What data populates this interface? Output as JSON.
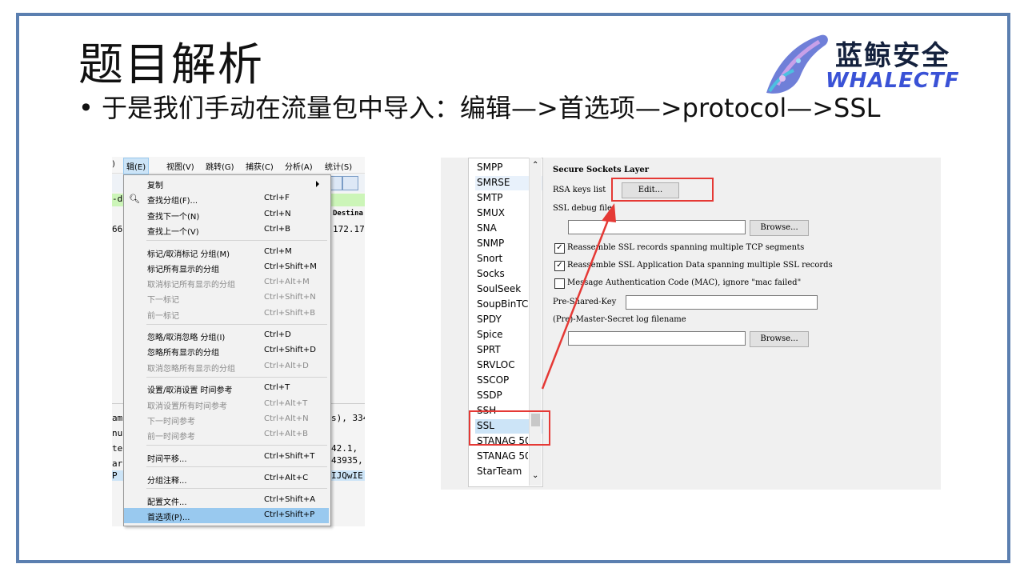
{
  "slide": {
    "title": "题目解析",
    "bullet": "• 于是我们手动在流量包中导入：编辑—>首选项—>protocol—>SSL"
  },
  "logo": {
    "cn": "蓝鲸安全",
    "en": "WHALECTF"
  },
  "left_screenshot": {
    "menubar": [
      "辑(E)",
      "视图(V)",
      "跳转(G)",
      "捕获(C)",
      "分析(A)",
      "统计(S)"
    ],
    "menubar_first": ")",
    "column_header": "Destina",
    "list_left": [
      "-d",
      "66"
    ],
    "list_right": [
      "172.17"
    ],
    "detail_left": [
      "am",
      "nu",
      "te",
      "ar",
      "P"
    ],
    "detail_right": [
      "s), 334",
      "42.1,",
      "43935,",
      "IJQwIE"
    ],
    "menu": {
      "items": [
        {
          "label": "复制",
          "shortcut": "",
          "disabled": false
        },
        {
          "label": "查找分组(F)...",
          "shortcut": "Ctrl+F",
          "disabled": false
        },
        {
          "label": "查找下一个(N)",
          "shortcut": "Ctrl+N",
          "disabled": false
        },
        {
          "label": "查找上一个(V)",
          "shortcut": "Ctrl+B",
          "disabled": false
        },
        {
          "label": "标记/取消标记 分组(M)",
          "shortcut": "Ctrl+M",
          "disabled": false
        },
        {
          "label": "标记所有显示的分组",
          "shortcut": "Ctrl+Shift+M",
          "disabled": false
        },
        {
          "label": "取消标记所有显示的分组",
          "shortcut": "Ctrl+Alt+M",
          "disabled": true
        },
        {
          "label": "下一标记",
          "shortcut": "Ctrl+Shift+N",
          "disabled": true
        },
        {
          "label": "前一标记",
          "shortcut": "Ctrl+Shift+B",
          "disabled": true
        },
        {
          "label": "忽略/取消忽略 分组(I)",
          "shortcut": "Ctrl+D",
          "disabled": false
        },
        {
          "label": "忽略所有显示的分组",
          "shortcut": "Ctrl+Shift+D",
          "disabled": false
        },
        {
          "label": "取消忽略所有显示的分组",
          "shortcut": "Ctrl+Alt+D",
          "disabled": true
        },
        {
          "label": "设置/取消设置 时间参考",
          "shortcut": "Ctrl+T",
          "disabled": false
        },
        {
          "label": "取消设置所有时间参考",
          "shortcut": "Ctrl+Alt+T",
          "disabled": true
        },
        {
          "label": "下一时间参考",
          "shortcut": "Ctrl+Alt+N",
          "disabled": true
        },
        {
          "label": "前一时间参考",
          "shortcut": "Ctrl+Alt+B",
          "disabled": true
        },
        {
          "label": "时间平移...",
          "shortcut": "Ctrl+Shift+T",
          "disabled": false
        },
        {
          "label": "分组注释...",
          "shortcut": "Ctrl+Alt+C",
          "disabled": false
        },
        {
          "label": "配置文件...",
          "shortcut": "Ctrl+Shift+A",
          "disabled": false
        },
        {
          "label": "首选项(P)...",
          "shortcut": "Ctrl+Shift+P",
          "disabled": false,
          "highlighted": true
        }
      ]
    }
  },
  "right_screenshot": {
    "protocols": [
      "SMPP",
      "SMRSE",
      "SMTP",
      "SMUX",
      "SNA",
      "SNMP",
      "Snort",
      "Socks",
      "SoulSeek",
      "SoupBinTC",
      "SPDY",
      "Spice",
      "SPRT",
      "SRVLOC",
      "SSCOP",
      "SSDP",
      "SSH",
      "SSL",
      "STANAG 50",
      "STANAG 50",
      "StarTeam"
    ],
    "selected_protocol": "SSL",
    "panel": {
      "heading": "Secure Sockets Layer",
      "rsa_label": "RSA keys list",
      "edit_button": "Edit...",
      "debug_label": "SSL debug file",
      "browse1": "Browse...",
      "check1": "Reassemble SSL records spanning multiple TCP segments",
      "check2": "Reassemble SSL Application Data spanning multiple SSL records",
      "check3": "Message Authentication Code (MAC), ignore \"mac failed\"",
      "psk_label": "Pre-Shared-Key",
      "mastersecret_label": "(Pre)-Master-Secret log filename",
      "browse2": "Browse..."
    },
    "checkbox_states": [
      true,
      true,
      false
    ]
  },
  "colors": {
    "frame": "#5b7fb0",
    "annotation_red": "#e53935",
    "menu_highlight": "#99c9ef"
  }
}
